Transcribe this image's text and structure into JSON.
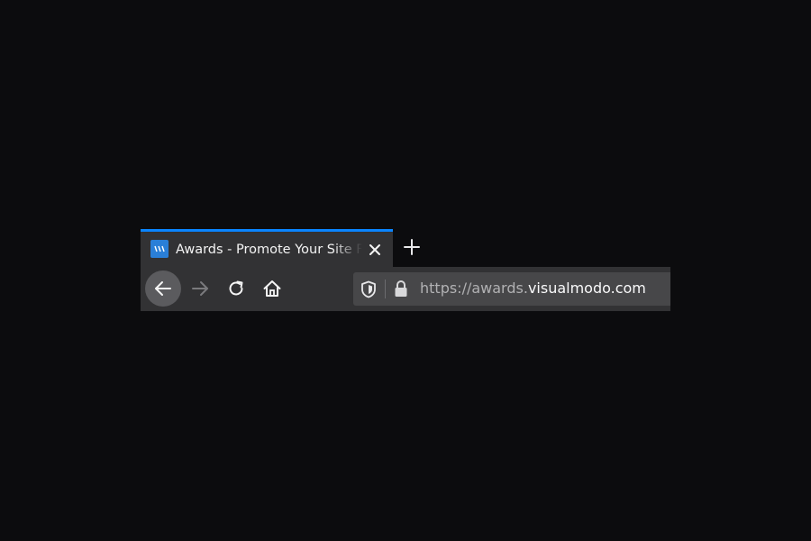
{
  "tab": {
    "title": "Awards - Promote Your Site For Free",
    "favicon_icon": "visualmodo-logo-icon",
    "close_icon": "close-icon"
  },
  "new_tab_icon": "plus-icon",
  "navigation": {
    "back_icon": "arrow-left-icon",
    "forward_icon": "arrow-right-icon",
    "reload_icon": "reload-icon",
    "home_icon": "home-icon"
  },
  "url_bar": {
    "tracking_protection_icon": "shield-icon",
    "security_icon": "lock-icon",
    "url_scheme": "https://",
    "url_subdomain": "awards.",
    "url_domain": "visualmodo.com"
  },
  "colors": {
    "page_background": "#0c0c0e",
    "toolbar": "#323234",
    "url_field": "#474749",
    "active_tab_accent": "#0a84ff",
    "favicon": "#2a7fd8"
  }
}
